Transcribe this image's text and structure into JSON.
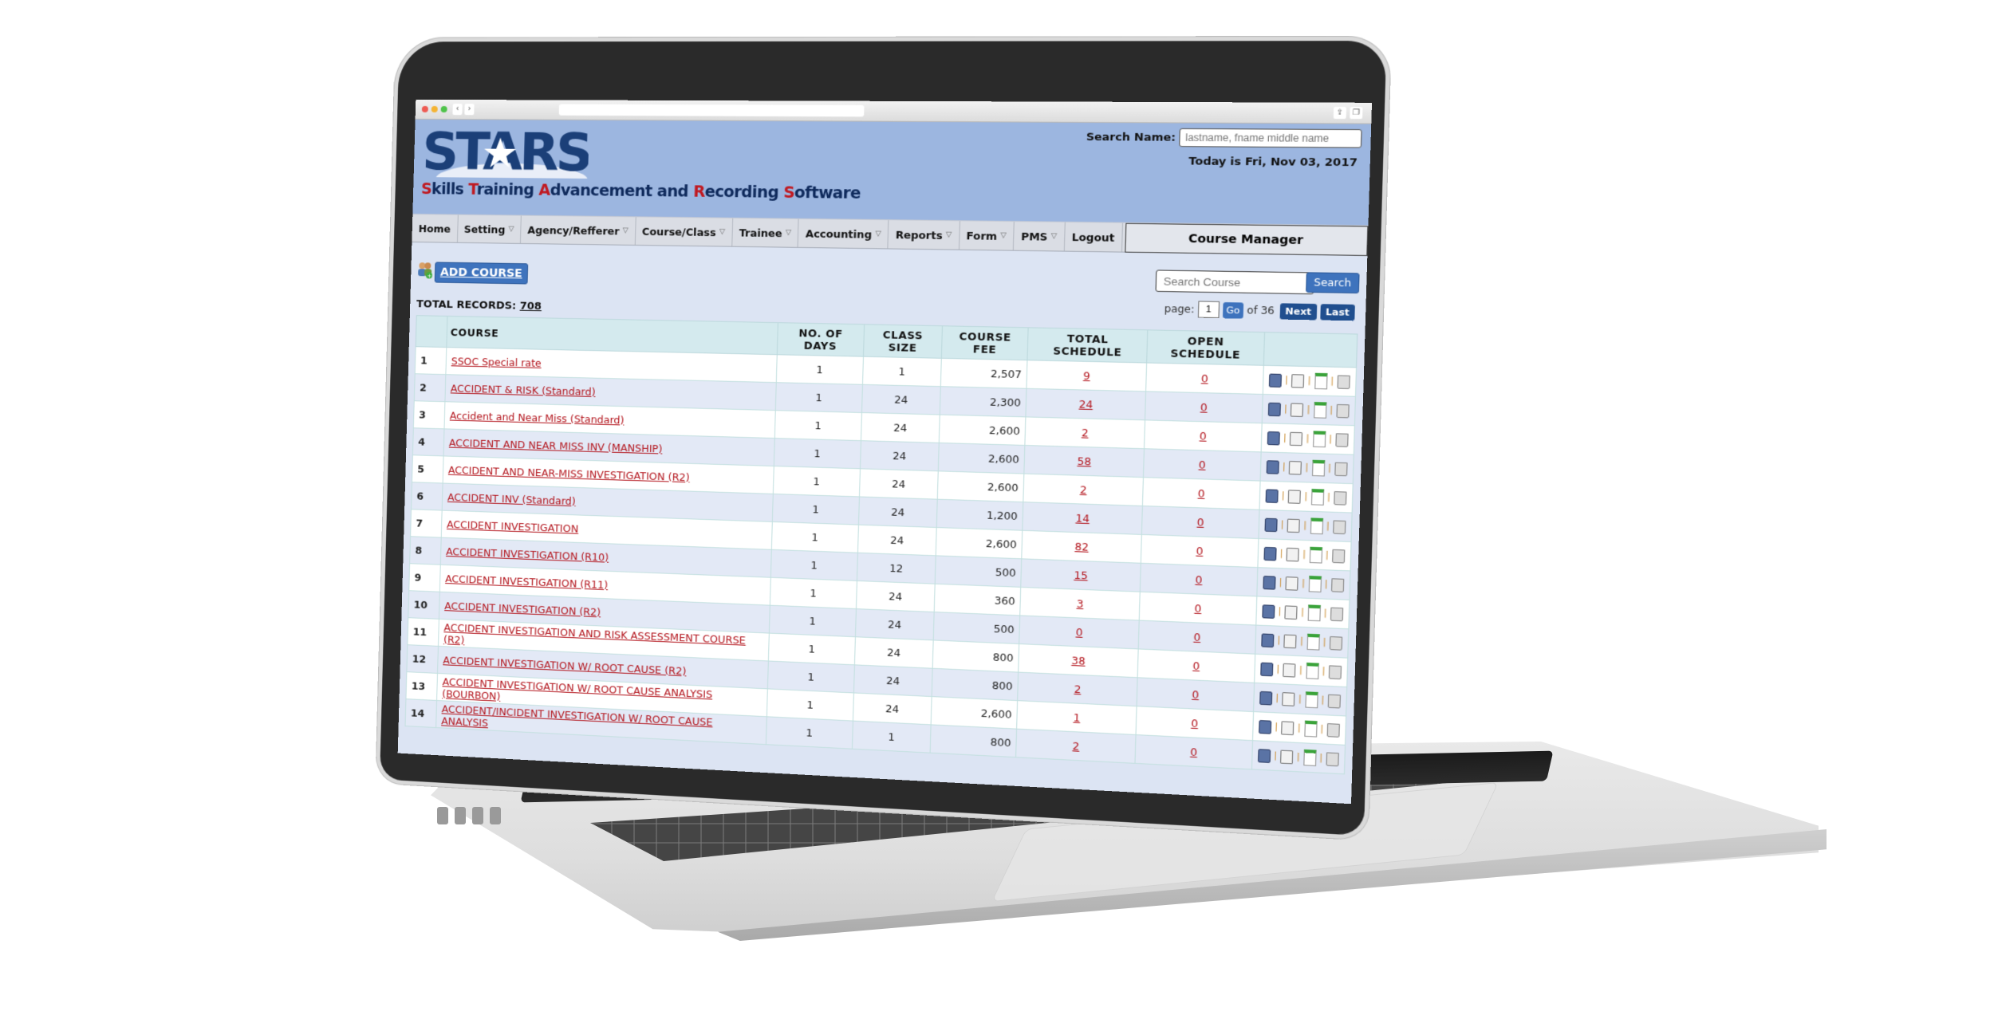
{
  "browser": {
    "back": "‹",
    "forward": "›",
    "share_icon": "⇪",
    "tabs_icon": "❐"
  },
  "header": {
    "logo_text": "STARS",
    "tagline_parts": [
      {
        "cap": "S",
        "rest": "kills "
      },
      {
        "cap": "T",
        "rest": "raining "
      },
      {
        "cap": "A",
        "rest": "dvancement and "
      },
      {
        "cap": "R",
        "rest": "ecording "
      },
      {
        "cap": "S",
        "rest": "oftware"
      }
    ],
    "search_name_label": "Search Name:",
    "search_name_placeholder": "lastname, fname middle name",
    "today": "Today is Fri, Nov 03, 2017",
    "brand_color": "#0f2a5c",
    "accent_color": "#c01921"
  },
  "menu": {
    "items": [
      {
        "label": "Home",
        "dropdown": false
      },
      {
        "label": "Setting",
        "dropdown": true
      },
      {
        "label": "Agency/Refferer",
        "dropdown": true
      },
      {
        "label": "Course/Class",
        "dropdown": true
      },
      {
        "label": "Trainee",
        "dropdown": true
      },
      {
        "label": "Accounting",
        "dropdown": true
      },
      {
        "label": "Reports",
        "dropdown": true
      },
      {
        "label": "Form",
        "dropdown": true
      },
      {
        "label": "PMS",
        "dropdown": true
      },
      {
        "label": "Logout",
        "dropdown": false
      }
    ],
    "module_title": "Course Manager"
  },
  "toolbar": {
    "add_course_label": "ADD COURSE",
    "search_placeholder": "Search Course",
    "search_button": "Search",
    "page_label": "page:",
    "page_value": "1",
    "go_label": "Go",
    "of_label": "of 36",
    "next_label": "Next",
    "last_label": "Last",
    "total_records_label": "TOTAL RECORDS:",
    "total_records_value": "708"
  },
  "table": {
    "columns": [
      "",
      "COURSE",
      "NO. OF DAYS",
      "CLASS SIZE",
      "COURSE FEE",
      "TOTAL SCHEDULE",
      "OPEN SCHEDULE",
      ""
    ],
    "rows": [
      {
        "n": "1",
        "course": "SSOC Special rate",
        "days": "1",
        "size": "1",
        "fee": "2,507",
        "total": "9",
        "open": "0"
      },
      {
        "n": "2",
        "course": "ACCIDENT & RISK (Standard)",
        "days": "1",
        "size": "24",
        "fee": "2,300",
        "total": "24",
        "open": "0"
      },
      {
        "n": "3",
        "course": "Accident and Near Miss (Standard)",
        "days": "1",
        "size": "24",
        "fee": "2,600",
        "total": "2",
        "open": "0"
      },
      {
        "n": "4",
        "course": "ACCIDENT AND NEAR MISS INV (MANSHIP)",
        "days": "1",
        "size": "24",
        "fee": "2,600",
        "total": "58",
        "open": "0"
      },
      {
        "n": "5",
        "course": "ACCIDENT AND NEAR-MISS INVESTIGATION (R2)",
        "days": "1",
        "size": "24",
        "fee": "2,600",
        "total": "2",
        "open": "0"
      },
      {
        "n": "6",
        "course": "ACCIDENT INV (Standard)",
        "days": "1",
        "size": "24",
        "fee": "1,200",
        "total": "14",
        "open": "0"
      },
      {
        "n": "7",
        "course": "ACCIDENT INVESTIGATION",
        "days": "1",
        "size": "24",
        "fee": "2,600",
        "total": "82",
        "open": "0"
      },
      {
        "n": "8",
        "course": "ACCIDENT INVESTIGATION (R10)",
        "days": "1",
        "size": "12",
        "fee": "500",
        "total": "15",
        "open": "0"
      },
      {
        "n": "9",
        "course": "ACCIDENT INVESTIGATION (R11)",
        "days": "1",
        "size": "24",
        "fee": "360",
        "total": "3",
        "open": "0"
      },
      {
        "n": "10",
        "course": "ACCIDENT INVESTIGATION (R2)",
        "days": "1",
        "size": "24",
        "fee": "500",
        "total": "0",
        "open": "0"
      },
      {
        "n": "11",
        "course": "ACCIDENT INVESTIGATION AND RISK ASSESSMENT COURSE (R2)",
        "days": "1",
        "size": "24",
        "fee": "800",
        "total": "38",
        "open": "0"
      },
      {
        "n": "12",
        "course": "ACCIDENT INVESTIGATION W/ ROOT CAUSE (R2)",
        "days": "1",
        "size": "24",
        "fee": "800",
        "total": "2",
        "open": "0"
      },
      {
        "n": "13",
        "course": "ACCIDENT INVESTIGATION W/ ROOT CAUSE ANALYSIS (BOURBON)",
        "days": "1",
        "size": "24",
        "fee": "2,600",
        "total": "1",
        "open": "0"
      },
      {
        "n": "14",
        "course": "ACCIDENT/INCIDENT INVESTIGATION W/ ROOT CAUSE ANALYSIS",
        "days": "1",
        "size": "1",
        "fee": "800",
        "total": "2",
        "open": "0"
      }
    ],
    "row_actions": [
      "edit-icon",
      "print-icon",
      "schedule-icon",
      "trash-icon"
    ],
    "link_color": "#b3141c",
    "header_bg": "#d4eaee",
    "row_alt_bg": "#e3e9f6"
  }
}
